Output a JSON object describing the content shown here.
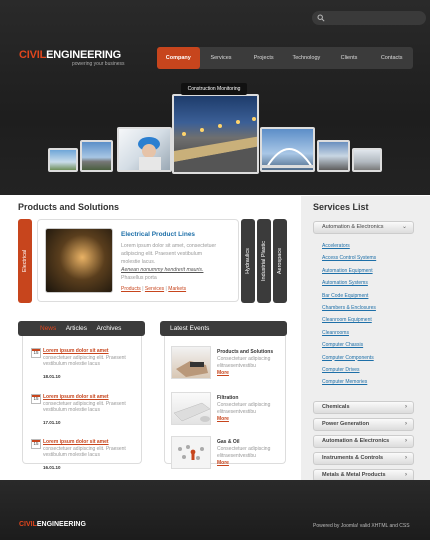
{
  "header": {
    "logo_part1": "CIVIL",
    "logo_part2": "ENGINEERING",
    "slogan": "powering your business",
    "nav": [
      "Company",
      "Services",
      "Projects",
      "Technology",
      "Clients",
      "Contacts"
    ],
    "active_nav": 0,
    "slider_tip": "Construction Monitoring"
  },
  "products": {
    "heading": "Products and Solutions",
    "tabs": [
      "Electrical",
      "Hydraulics",
      "Industrial Plastic",
      "Aerospace"
    ],
    "title": "Electrical Product Lines",
    "text1": "Lorem ipsum dolor sit amet, consectetuer",
    "text2": "adipiscing elit. Praesent vestibulum",
    "text3": "molestie lacus.",
    "text_italic": "Aenean nonummy hendrerit mauris.",
    "text4": "Phasellus porta",
    "links": [
      "Products",
      "Services",
      "Markets"
    ]
  },
  "news": {
    "tabs": [
      "News",
      "Articles",
      "Archives"
    ],
    "items": [
      {
        "day": "15",
        "title": "Lorem ipsum dolor sit amet",
        "text": "consectetuer adipiscing elit. Praesent vestibulum molestie lacus",
        "date": "18.01.10"
      },
      {
        "day": "15",
        "title": "Lorem ipsum dolor sit amet",
        "text": "consectetuer adipiscing elit. Praesent vestibulum molestie lacus",
        "date": "17.01.10"
      },
      {
        "day": "15",
        "title": "Lorem ipsum dolor sit amet",
        "text": "consectetuer adipiscing elit. Praesent vestibulum molestie lacus",
        "date": "16.01.10"
      }
    ]
  },
  "events": {
    "heading": "Latest Events",
    "items": [
      {
        "title": "Products and Solutions",
        "text": "Consectetuer adipiscing elitraesentvestibu",
        "more": "More"
      },
      {
        "title": "Filtration",
        "text": "Consectetuer adipiscing elitraesentvestibu",
        "more": "More"
      },
      {
        "title": "Gas & Oil",
        "text": "Consectetuer adipiscing elitraesentvestibu",
        "more": "More"
      }
    ]
  },
  "services": {
    "heading": "Services List",
    "open_group": "Automation & Electronics",
    "list": [
      "Accelerators",
      "Access Control Systems",
      "Automation Equipment",
      "Automation Systems",
      "Bar Code Equipment",
      "Chambers & Enclosures",
      "Cleanroom Equipment",
      "Cleanrooms",
      "Computer Chassis",
      "Computer Components",
      "Computer Drives",
      "Computer Memories"
    ],
    "groups": [
      "Chemicals",
      "Power Generation",
      "Automation & Electronics",
      "Instruments & Controls",
      "Metals & Metal Products"
    ]
  },
  "footer": {
    "logo_part1": "CIVIL",
    "logo_part2": "ENGINEERING",
    "text": "Powered by Joomla! valid XHTML and CSS"
  },
  "colors": {
    "accent": "#c7451d",
    "link": "#1d6fa8",
    "dark": "#2a2a2a"
  }
}
